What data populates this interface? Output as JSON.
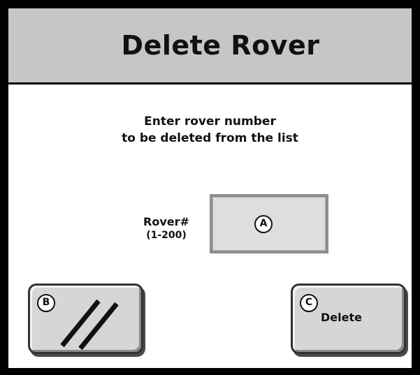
{
  "window": {
    "title": "Delete Rover"
  },
  "instructions": {
    "line1": "Enter rover number",
    "line2": "to be deleted from the list"
  },
  "rover_field": {
    "label": "Rover#",
    "range": "(1-200)",
    "badge": "A",
    "value": ""
  },
  "clear_button": {
    "badge": "B",
    "icon": "double-slash-clear-icon"
  },
  "delete_button": {
    "badge": "C",
    "label": "Delete"
  }
}
